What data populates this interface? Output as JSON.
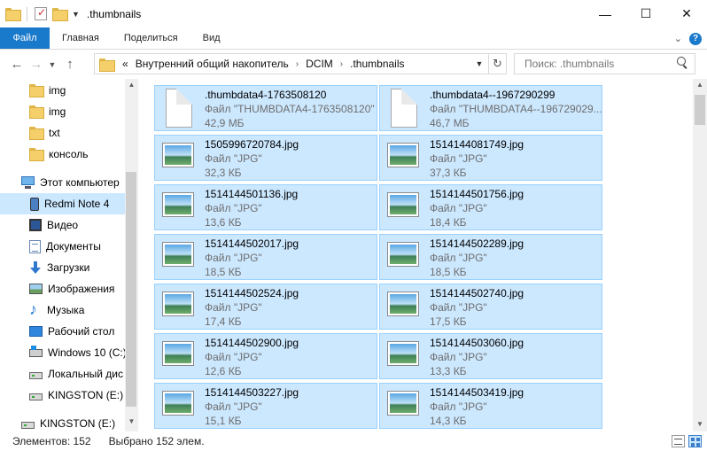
{
  "window": {
    "title": ".thumbnails",
    "minimize_glyph": "—",
    "maximize_glyph": "☐",
    "close_glyph": "✕"
  },
  "ribbon": {
    "tabs": [
      "Файл",
      "Главная",
      "Поделиться",
      "Вид"
    ],
    "help_glyph": "?"
  },
  "address": {
    "overflow": "«",
    "crumbs": [
      "Внутренний общий накопитель",
      "DCIM",
      ".thumbnails"
    ]
  },
  "search": {
    "placeholder": "Поиск: .thumbnails"
  },
  "sidebar": {
    "items": [
      {
        "label": "img",
        "icon": "folder-icon"
      },
      {
        "label": "img",
        "icon": "folder-icon"
      },
      {
        "label": "txt",
        "icon": "folder-icon"
      },
      {
        "label": "консоль",
        "icon": "folder-icon"
      },
      {
        "label": "Этот компьютер",
        "icon": "computer-icon"
      },
      {
        "label": "Redmi Note 4",
        "icon": "phone-icon",
        "selected": true
      },
      {
        "label": "Видео",
        "icon": "video-icon"
      },
      {
        "label": "Документы",
        "icon": "documents-icon"
      },
      {
        "label": "Загрузки",
        "icon": "downloads-icon"
      },
      {
        "label": "Изображения",
        "icon": "pictures-icon"
      },
      {
        "label": "Музыка",
        "icon": "music-icon"
      },
      {
        "label": "Рабочий стол",
        "icon": "desktop-icon"
      },
      {
        "label": "Windows 10 (C:)",
        "icon": "windows-drive-icon"
      },
      {
        "label": "Локальный дис",
        "icon": "drive-icon"
      },
      {
        "label": "KINGSTON (E:)",
        "icon": "drive-icon"
      },
      {
        "label": "KINGSTON (E:)",
        "icon": "drive-icon"
      }
    ]
  },
  "files": [
    {
      "name": ".thumbdata4-1763508120",
      "type": "Файл \"THUMBDATA4-1763508120\"",
      "size": "42,9 МБ",
      "kind": "document"
    },
    {
      "name": ".thumbdata4--1967290299",
      "type": "Файл \"THUMBDATA4--196729029...",
      "size": "46,7 МБ",
      "kind": "document"
    },
    {
      "name": "1505996720784.jpg",
      "type": "Файл \"JPG\"",
      "size": "32,3 КБ",
      "kind": "image"
    },
    {
      "name": "1514144081749.jpg",
      "type": "Файл \"JPG\"",
      "size": "37,3 КБ",
      "kind": "image"
    },
    {
      "name": "1514144501136.jpg",
      "type": "Файл \"JPG\"",
      "size": "13,6 КБ",
      "kind": "image"
    },
    {
      "name": "1514144501756.jpg",
      "type": "Файл \"JPG\"",
      "size": "18,4 КБ",
      "kind": "image"
    },
    {
      "name": "1514144502017.jpg",
      "type": "Файл \"JPG\"",
      "size": "18,5 КБ",
      "kind": "image"
    },
    {
      "name": "1514144502289.jpg",
      "type": "Файл \"JPG\"",
      "size": "18,5 КБ",
      "kind": "image"
    },
    {
      "name": "1514144502524.jpg",
      "type": "Файл \"JPG\"",
      "size": "17,4 КБ",
      "kind": "image"
    },
    {
      "name": "1514144502740.jpg",
      "type": "Файл \"JPG\"",
      "size": "17,5 КБ",
      "kind": "image"
    },
    {
      "name": "1514144502900.jpg",
      "type": "Файл \"JPG\"",
      "size": "12,6 КБ",
      "kind": "image"
    },
    {
      "name": "1514144503060.jpg",
      "type": "Файл \"JPG\"",
      "size": "13,3 КБ",
      "kind": "image"
    },
    {
      "name": "1514144503227.jpg",
      "type": "Файл \"JPG\"",
      "size": "15,1 КБ",
      "kind": "image"
    },
    {
      "name": "1514144503419.jpg",
      "type": "Файл \"JPG\"",
      "size": "14,3 КБ",
      "kind": "image"
    }
  ],
  "status": {
    "count": "Элементов: 152",
    "selected": "Выбрано 152 элем."
  },
  "colors": {
    "accent": "#1979ca",
    "selection": "#cce8ff",
    "selection_border": "#99d1ff"
  }
}
